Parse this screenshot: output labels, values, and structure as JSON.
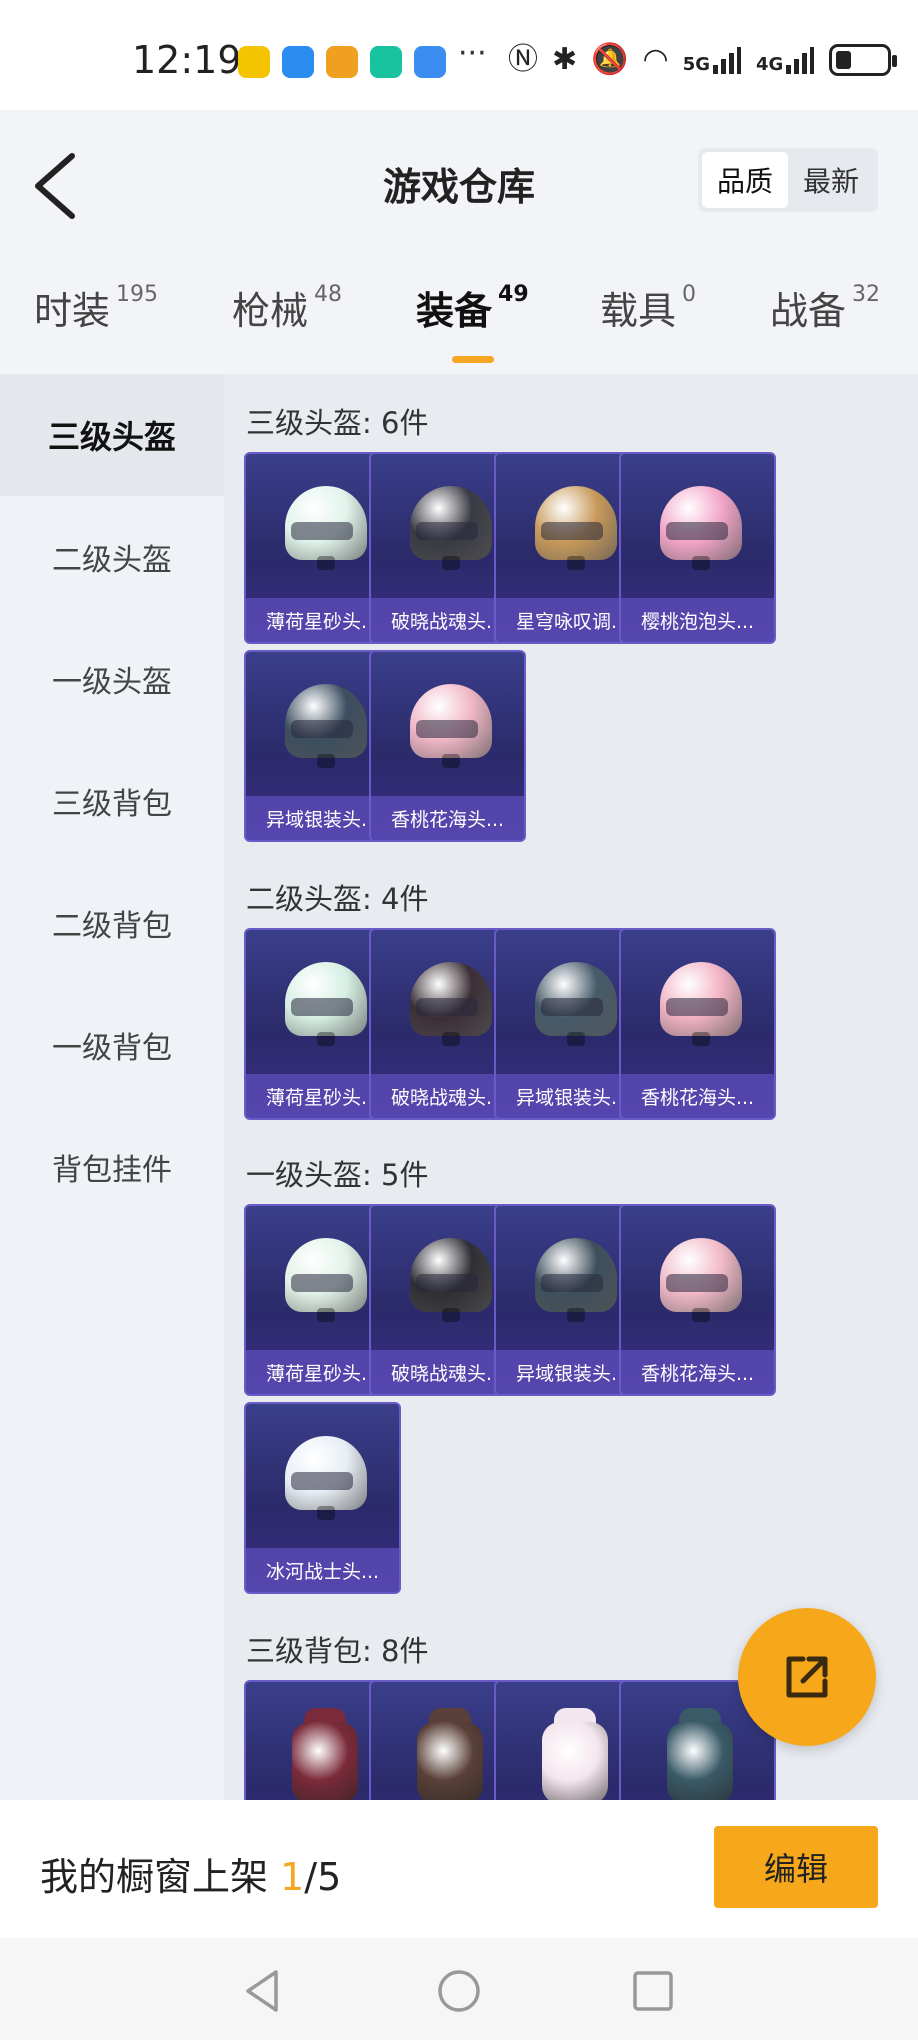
{
  "status_bar": {
    "time": "12:19",
    "more": "···",
    "app_icons": [
      "#f5c400",
      "#2b8cf0",
      "#f0a020",
      "#18c3a0",
      "#3b8df2"
    ],
    "signal_5g": "5G",
    "signal_4g": "4G",
    "battery_level": 0.3
  },
  "header": {
    "title": "游戏仓库",
    "sort_options": [
      "品质",
      "最新"
    ],
    "sort_selected": "品质"
  },
  "tabs": [
    {
      "label": "时装",
      "count": "195"
    },
    {
      "label": "枪械",
      "count": "48"
    },
    {
      "label": "装备",
      "count": "49"
    },
    {
      "label": "载具",
      "count": "0"
    },
    {
      "label": "战备",
      "count": "32"
    }
  ],
  "active_tab": "装备",
  "sidebar": {
    "items": [
      "三级头盔",
      "二级头盔",
      "一级头盔",
      "三级背包",
      "二级背包",
      "一级背包",
      "背包挂件"
    ],
    "active": "三级头盔"
  },
  "sections": [
    {
      "title": "三级头盔: 6件",
      "items": [
        {
          "name": "薄荷星砂头...",
          "kind": "helmet",
          "color": "#dff3ea"
        },
        {
          "name": "破晓战魂头...",
          "kind": "helmet",
          "color": "#3a3a44"
        },
        {
          "name": "星穹咏叹调...",
          "kind": "helmet",
          "color": "#c89a5a"
        },
        {
          "name": "樱桃泡泡头...",
          "kind": "helmet",
          "color": "#f3a6c8"
        },
        {
          "name": "异域银装头...",
          "kind": "helmet",
          "color": "#3c4e60"
        },
        {
          "name": "香桃花海头...",
          "kind": "helmet",
          "color": "#f0b6c6"
        }
      ]
    },
    {
      "title": "二级头盔: 4件",
      "items": [
        {
          "name": "薄荷星砂头...",
          "kind": "helmet",
          "color": "#d6efe4"
        },
        {
          "name": "破晓战魂头...",
          "kind": "helmet",
          "color": "#3b2f36"
        },
        {
          "name": "异域银装头...",
          "kind": "helmet",
          "color": "#465a6a"
        },
        {
          "name": "香桃花海头...",
          "kind": "helmet",
          "color": "#f2b2c4"
        }
      ]
    },
    {
      "title": "一级头盔: 5件",
      "items": [
        {
          "name": "薄荷星砂头...",
          "kind": "helmet",
          "color": "#e2f2e8"
        },
        {
          "name": "破晓战魂头...",
          "kind": "helmet",
          "color": "#2e2e34"
        },
        {
          "name": "异域银装头...",
          "kind": "helmet",
          "color": "#3e4f5c"
        },
        {
          "name": "香桃花海头...",
          "kind": "helmet",
          "color": "#f1b9c8"
        },
        {
          "name": "冰河战士头...",
          "kind": "helmet",
          "color": "#e8eef6"
        }
      ]
    },
    {
      "title": "三级背包: 8件",
      "items": [
        {
          "name": "",
          "kind": "backpack",
          "color": "#7a2a3a"
        },
        {
          "name": "",
          "kind": "backpack",
          "color": "#5a4038"
        },
        {
          "name": "",
          "kind": "backpack",
          "color": "#f4e6ee"
        },
        {
          "name": "",
          "kind": "backpack",
          "color": "#3a5a68"
        }
      ]
    }
  ],
  "bottom": {
    "shelf_label": "我的橱窗上架",
    "shelf_current": "1",
    "shelf_total": "/5",
    "edit_label": "编辑"
  }
}
